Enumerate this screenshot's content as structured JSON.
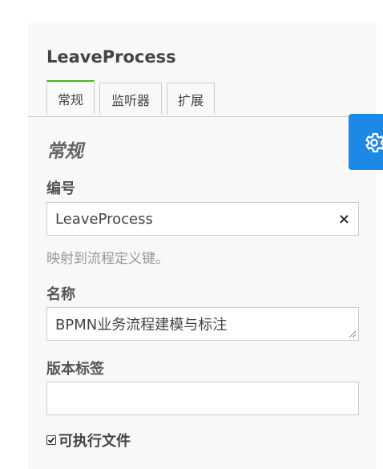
{
  "process": {
    "title": "LeaveProcess"
  },
  "tabs": [
    {
      "label": "常规",
      "active": true
    },
    {
      "label": "监听器",
      "active": false
    },
    {
      "label": "扩展",
      "active": false
    }
  ],
  "group": {
    "title": "常规"
  },
  "fields": {
    "id": {
      "label": "编号",
      "value": "LeaveProcess",
      "description": "映射到流程定义键。"
    },
    "name": {
      "label": "名称",
      "value": "BPMN业务流程建模与标注"
    },
    "version_tag": {
      "label": "版本标签",
      "value": ""
    }
  },
  "executable": {
    "label": "可执行文件",
    "checked": true
  },
  "toggle": {
    "icon": "gear-icon",
    "color": "#1e88e5"
  },
  "colors": {
    "accent_tab": "#52b415",
    "toggle_bg": "#1e88e5"
  }
}
